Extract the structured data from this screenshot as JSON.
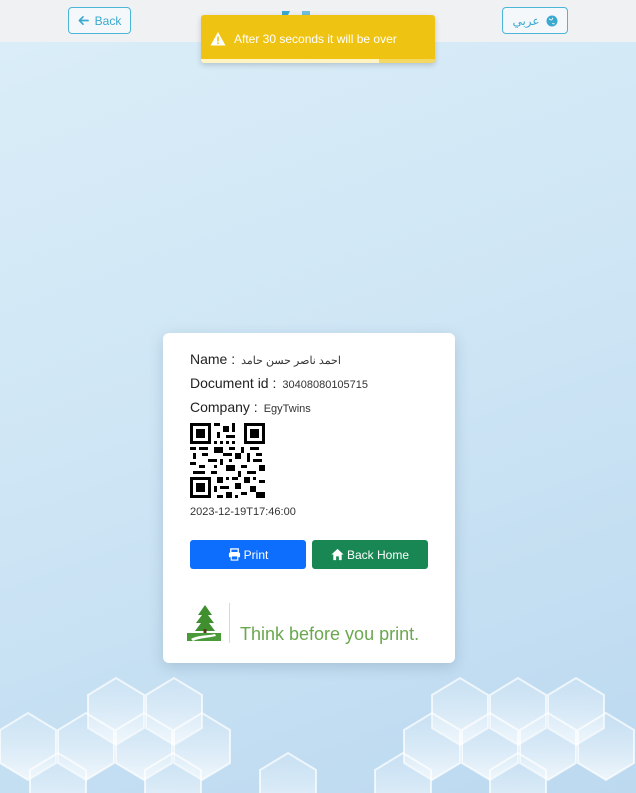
{
  "header": {
    "back_label": "Back",
    "lang_label": "عربي"
  },
  "toast": {
    "message": "After 30 seconds it will be over",
    "progress": 0.76,
    "color": "#efc312"
  },
  "card": {
    "name_label": "Name :",
    "name_value": "احمد ناصر حسن حامد",
    "doc_label": "Document id :",
    "doc_value": "30408080105715",
    "company_label": "Company :",
    "company_value": "EgyTwins",
    "timestamp": "2023-12-19T17:46:00",
    "print_label": "Print",
    "home_label": "Back Home",
    "eco_text": "Think before you print."
  },
  "colors": {
    "print": "#0d6efd",
    "home": "#198754",
    "accent": "#3aa9cf"
  }
}
